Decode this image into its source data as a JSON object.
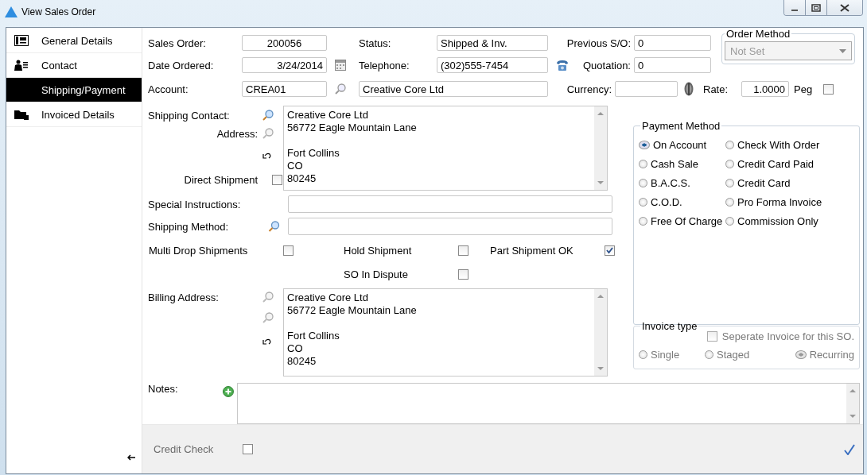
{
  "window": {
    "title": "View Sales Order"
  },
  "sidebar": {
    "items": [
      {
        "label": "General Details",
        "selected": false
      },
      {
        "label": "Contact",
        "selected": false
      },
      {
        "label": "Shipping/Payment",
        "selected": true
      },
      {
        "label": "Invoiced Details",
        "selected": false
      }
    ]
  },
  "header": {
    "sales_order": {
      "label": "Sales Order:",
      "value": "200056"
    },
    "date_ordered": {
      "label": "Date Ordered:",
      "value": "3/24/2014"
    },
    "account": {
      "label": "Account:",
      "value": "CREA01",
      "name": "Creative Core Ltd"
    },
    "status": {
      "label": "Status:",
      "value": "Shipped & Inv."
    },
    "telephone": {
      "label": "Telephone:",
      "value": "(302)555-7454"
    },
    "previous_so": {
      "label": "Previous S/O:",
      "value": "0"
    },
    "quotation": {
      "label": "Quotation:",
      "value": "0"
    },
    "currency": {
      "label": "Currency:"
    },
    "rate": {
      "label": "Rate:",
      "value": "1.0000"
    },
    "peg": {
      "label": "Peg",
      "checked": false
    }
  },
  "order_method": {
    "title": "Order Method",
    "value": "Not Set",
    "disabled": true
  },
  "shipping": {
    "contact_label": "Shipping Contact:",
    "address_label": "Address:",
    "address": "Creative Core Ltd\n56772 Eagle Mountain Lane\n\nFort Collins\nCO\n80245",
    "direct_shipment": {
      "label": "Direct Shipment",
      "checked": false
    }
  },
  "special_instructions": {
    "label": "Special Instructions:"
  },
  "shipping_method": {
    "label": "Shipping Method:"
  },
  "options": [
    {
      "label": "Multi Drop Shipments",
      "checked": false
    },
    {
      "label": "Hold Shipment",
      "checked": false
    },
    {
      "label": "Part Shipment OK",
      "checked": true
    },
    {
      "label": "SO In Dispute",
      "checked": false
    }
  ],
  "billing": {
    "label": "Billing Address:",
    "address": "Creative Core Ltd\n56772 Eagle Mountain Lane\n\nFort Collins\nCO\n80245"
  },
  "notes": {
    "label": "Notes:"
  },
  "payment_method": {
    "title": "Payment Method",
    "options": [
      {
        "label": "On Account",
        "selected": true
      },
      {
        "label": "Check With Order",
        "selected": false
      },
      {
        "label": "Cash Sale",
        "selected": false
      },
      {
        "label": "Credit Card Paid",
        "selected": false
      },
      {
        "label": "B.A.C.S.",
        "selected": false
      },
      {
        "label": "Credit Card",
        "selected": false
      },
      {
        "label": "C.O.D.",
        "selected": false
      },
      {
        "label": "Pro Forma Invoice",
        "selected": false
      },
      {
        "label": "Free Of Charge",
        "selected": false
      },
      {
        "label": "Commission Only",
        "selected": false
      }
    ]
  },
  "invoice_type": {
    "title": "Invoice type",
    "disabled": true,
    "separate": {
      "label": "Seperate Invoice for this SO.",
      "checked": false
    },
    "options": [
      {
        "label": "Single",
        "selected": false
      },
      {
        "label": "Staged",
        "selected": false
      },
      {
        "label": "Recurring",
        "selected": true
      }
    ]
  },
  "footer": {
    "credit_check": {
      "label": "Credit Check",
      "checked": false,
      "disabled": true
    }
  }
}
